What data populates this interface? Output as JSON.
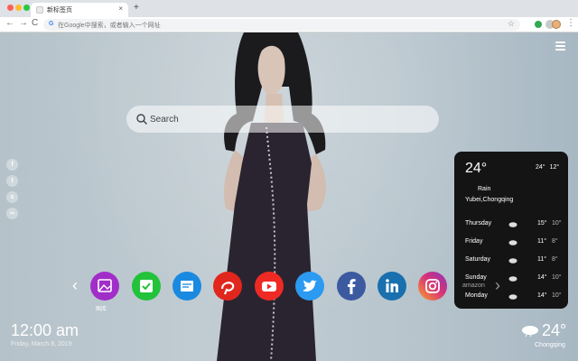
{
  "browser": {
    "tab_title": "新标签页",
    "tab_close": "×",
    "new_tab": "+",
    "nav_back": "←",
    "nav_forward": "→",
    "nav_reload": "C",
    "address_placeholder": "在Google中搜索，或者输入一个网址",
    "google_letter": "G",
    "bookmark_star": "☆",
    "menu": "⋮"
  },
  "search": {
    "placeholder": "Search"
  },
  "social_icons": [
    {
      "name": "facebook-small-icon",
      "glyph": "f"
    },
    {
      "name": "twitter-small-icon",
      "glyph": "t"
    },
    {
      "name": "snapchat-small-icon",
      "glyph": "s"
    },
    {
      "name": "link-small-icon",
      "glyph": "∞"
    }
  ],
  "weather_card": {
    "temp": "24°",
    "high": "24°",
    "low": "12°",
    "condition": "Rain",
    "location": "Yubei,Chongqing",
    "forecast": [
      {
        "day": "Thursday",
        "high": "15°",
        "low": "10°"
      },
      {
        "day": "Friday",
        "high": "11°",
        "low": "8°"
      },
      {
        "day": "Saturday",
        "high": "11°",
        "low": "8°"
      },
      {
        "day": "Sunday",
        "high": "14°",
        "low": "10°"
      },
      {
        "day": "Monday",
        "high": "14°",
        "low": "10°"
      }
    ]
  },
  "dock": {
    "gallery_label": "图库",
    "amazon_label": "amazon",
    "left_arrow": "‹",
    "right_arrow": "›",
    "apps": [
      {
        "name": "gallery",
        "color": "#a12ec9"
      },
      {
        "name": "tasks",
        "color": "#22c23b"
      },
      {
        "name": "notes",
        "color": "#1a8ae0"
      },
      {
        "name": "pinterest",
        "color": "#e0261d"
      },
      {
        "name": "youtube",
        "color": "#ef2a24"
      },
      {
        "name": "twitter",
        "color": "#2b9af0"
      },
      {
        "name": "facebook",
        "color": "#3b5aa0"
      },
      {
        "name": "linkedin",
        "color": "#1a6fae"
      },
      {
        "name": "instagram",
        "color": "#d6317a"
      }
    ]
  },
  "clock": {
    "time": "12:00 am",
    "date": "Friday, March 8, 2019"
  },
  "bottom_weather": {
    "temp": "24°",
    "city": "Chongqing"
  }
}
